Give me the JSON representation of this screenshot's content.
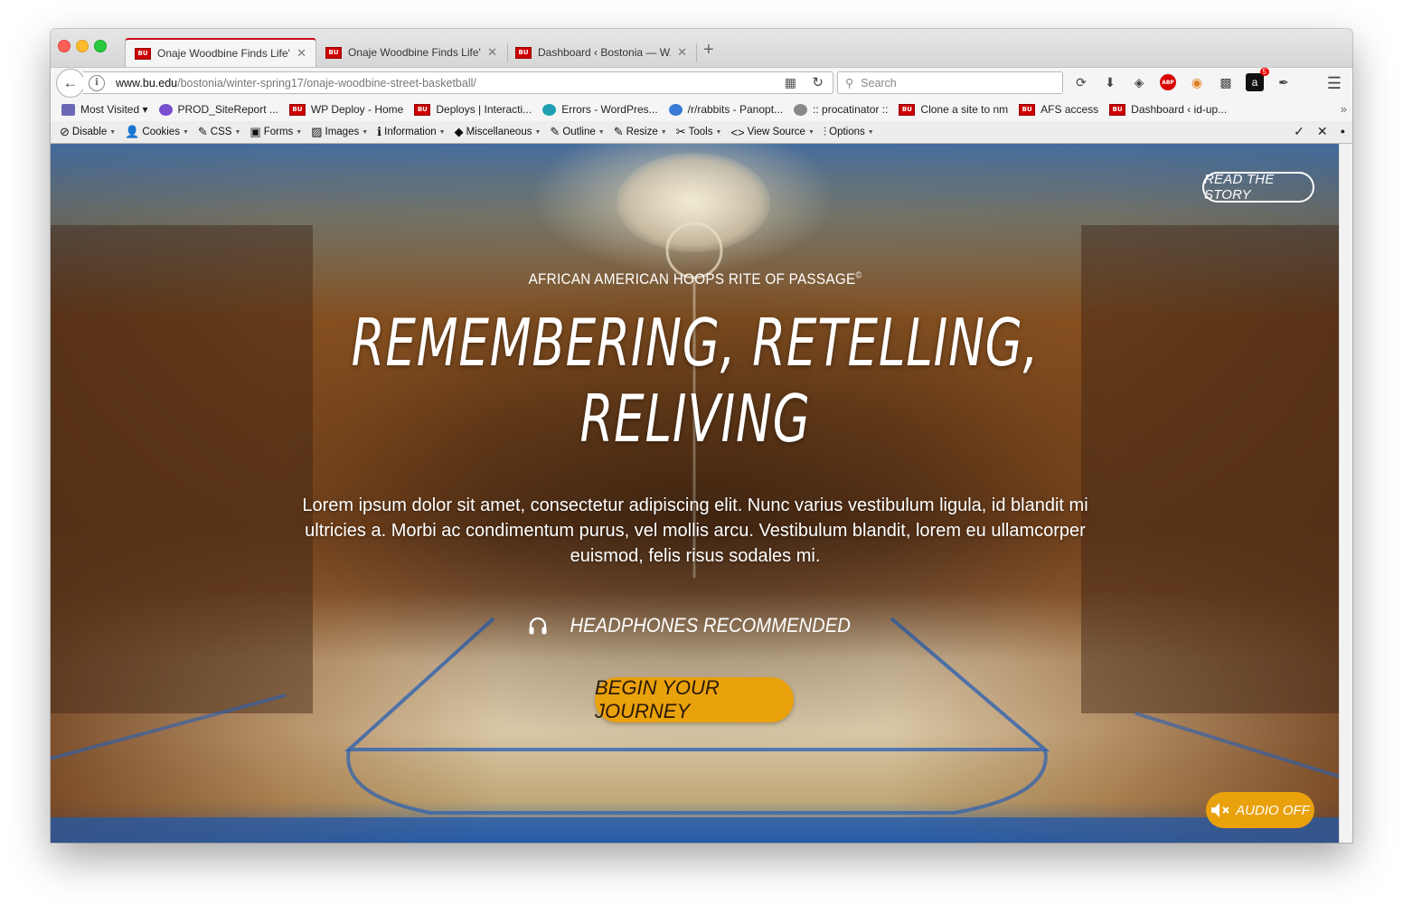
{
  "tabs": [
    {
      "title": "Onaje Woodbine Finds Life'...",
      "favicon": "BU"
    },
    {
      "title": "Onaje Woodbine Finds Life'...",
      "favicon": "BU"
    },
    {
      "title": "Dashboard ‹ Bostonia — W...",
      "favicon": "BU"
    }
  ],
  "nav": {
    "url_domain": "www.bu.edu",
    "url_path": "/bostonia/winter-spring17/onaje-woodbine-street-basketball/",
    "search_placeholder": "Search",
    "badge_count": "5"
  },
  "bookmarks": [
    {
      "label": "Most Visited ▾",
      "icon": "most-visited-icon",
      "color": "#6b68b8"
    },
    {
      "label": "PROD_SiteReport ...",
      "icon": "prod-icon",
      "color": "#7a4fd0"
    },
    {
      "label": "WP Deploy - Home",
      "icon": "bu-icon",
      "color": "#cc0000"
    },
    {
      "label": "Deploys | Interacti...",
      "icon": "bu-icon",
      "color": "#cc0000"
    },
    {
      "label": "Errors - WordPres...",
      "icon": "errors-icon",
      "color": "#20a0b0"
    },
    {
      "label": "/r/rabbits - Panopt...",
      "icon": "shield-icon",
      "color": "#3a7bd5"
    },
    {
      "label": ":: procatinator ::",
      "icon": "globe-icon",
      "color": "#888888"
    },
    {
      "label": "Clone a site to nm",
      "icon": "bu-icon",
      "color": "#cc0000"
    },
    {
      "label": "AFS access",
      "icon": "bu-icon",
      "color": "#cc0000"
    },
    {
      "label": "Dashboard ‹ id-up...",
      "icon": "bu-icon",
      "color": "#cc0000"
    }
  ],
  "devtools": [
    {
      "label": "Disable",
      "icon": "⊘"
    },
    {
      "label": "Cookies",
      "icon": "👤"
    },
    {
      "label": "CSS",
      "icon": "✎"
    },
    {
      "label": "Forms",
      "icon": "▣"
    },
    {
      "label": "Images",
      "icon": "▨"
    },
    {
      "label": "Information",
      "icon": "ℹ"
    },
    {
      "label": "Miscellaneous",
      "icon": "◆"
    },
    {
      "label": "Outline",
      "icon": "✎"
    },
    {
      "label": "Resize",
      "icon": "✎"
    },
    {
      "label": "Tools",
      "icon": "✂"
    },
    {
      "label": "View Source",
      "icon": "<>"
    },
    {
      "label": "Options",
      "icon": "⫶"
    }
  ],
  "page": {
    "read_story": "READ THE STORY",
    "kicker": "AFRICAN AMERICAN HOOPS RITE OF PASSAGE",
    "kicker_mark": "©",
    "headline_line1": "REMEMBERING, RETELLING,",
    "headline_line2": "RELIVING",
    "lede": "Lorem ipsum dolor sit amet, consectetur adipiscing elit. Nunc varius vestibulum ligula, id blandit mi ultricies a. Morbi ac condimentum purus, vel mollis arcu. Vestibulum blandit, lorem eu ullamcorper euismod, felis risus sodales mi.",
    "headphones": "HEADPHONES RECOMMENDED",
    "begin": "BEGIN YOUR JOURNEY",
    "audio": "AUDIO OFF"
  },
  "colors": {
    "accent_button": "#e9a10c",
    "bu_red": "#cc0000"
  }
}
